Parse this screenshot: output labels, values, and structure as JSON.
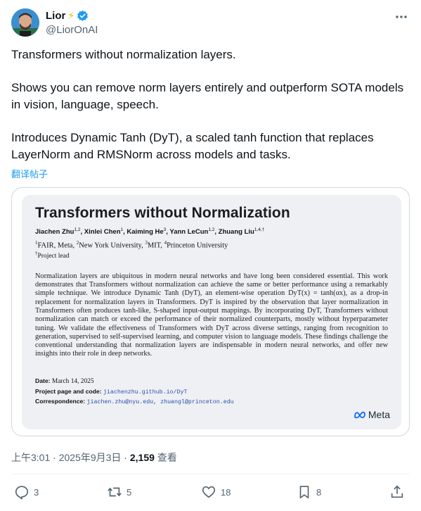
{
  "author": {
    "display_name": "Lior",
    "name_emoji": "⚡",
    "verified_icon": "verified-badge-icon",
    "handle": "@LiorOnAI",
    "avatar_icon": "avatar-photo"
  },
  "tweet": {
    "paragraphs": [
      "Transformers without normalization layers.",
      "Shows you can remove norm layers entirely and outperform SOTA models in vision, language, speech.",
      "Introduces Dynamic Tanh (DyT), a scaled tanh function that replaces LayerNorm and RMSNorm across models and tasks."
    ],
    "translate_label": "翻译帖子"
  },
  "paper": {
    "title": "Transformers without Normalization",
    "authors": [
      {
        "name": "Jiachen Zhu",
        "sup": "1,2"
      },
      {
        "name": "Xinlei Chen",
        "sup": "1"
      },
      {
        "name": "Kaiming He",
        "sup": "3"
      },
      {
        "name": "Yann LeCun",
        "sup": "1,2"
      },
      {
        "name": "Zhuang Liu",
        "sup": "1,4,†"
      }
    ],
    "affiliations": [
      {
        "sup": "1",
        "text": "FAIR, Meta, "
      },
      {
        "sup": "2",
        "text": "New York University, "
      },
      {
        "sup": "3",
        "text": "MIT, "
      },
      {
        "sup": "4",
        "text": "Princeton University"
      }
    ],
    "lead_sup": "†",
    "lead_text": "Project lead",
    "abstract": "Normalization layers are ubiquitous in modern neural networks and have long been considered essential. This work demonstrates that Transformers without normalization can achieve the same or better performance using a remarkably simple technique. We introduce Dynamic Tanh (DyT), an element-wise operation DyT(x) = tanh(αx), as a drop-in replacement for normalization layers in Transformers. DyT is inspired by the observation that layer normalization in Transformers often produces tanh-like, S-shaped input-output mappings. By incorporating DyT, Transformers without normalization can match or exceed the performance of their normalized counterparts, mostly without hyperparameter tuning. We validate the effectiveness of Transformers with DyT across diverse settings, ranging from recognition to generation, supervised to self-supervised learning, and computer vision to language models. These findings challenge the conventional understanding that normalization layers are indispensable in modern neural networks, and offer new insights into their role in deep networks.",
    "date_label": "Date:",
    "date_value": "March 14, 2025",
    "project_label": "Project page and code:",
    "project_value": "jiachenzhu.github.io/DyT",
    "correspondence_label": "Correspondence:",
    "correspondence_value": "jiachen.zhu@nyu.edu, zhuangl@princeton.edu",
    "logo_text": "Meta"
  },
  "meta": {
    "time": "上午3:01 · 2025年9月3日 · ",
    "views_count": "2,159",
    "views_label": " 查看"
  },
  "actions": {
    "replies": "3",
    "reposts": "5",
    "likes": "18",
    "bookmarks": "8"
  },
  "colors": {
    "accent": "#1d9bf0",
    "text_primary": "#0f1419",
    "text_secondary": "#536471",
    "border": "#cfd9de"
  }
}
